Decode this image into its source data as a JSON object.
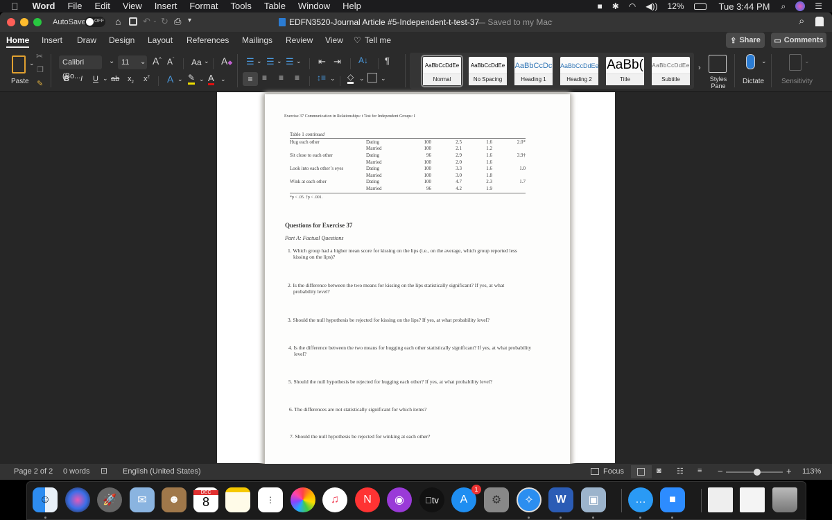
{
  "menubar": {
    "apple": "",
    "app": "Word",
    "items": [
      "File",
      "Edit",
      "View",
      "Insert",
      "Format",
      "Tools",
      "Table",
      "Window",
      "Help"
    ],
    "battery": "12%",
    "clock": "Tue 3:44 PM"
  },
  "titlebar": {
    "autosave_label": "AutoSave",
    "autosave_state": "OFF",
    "doc_title": "EDFN3520-Journal Article #5-Independent-t-test-37",
    "save_status": "— Saved to my Mac"
  },
  "tabs": [
    "Home",
    "Insert",
    "Draw",
    "Design",
    "Layout",
    "References",
    "Mailings",
    "Review",
    "View"
  ],
  "tell_me": "Tell me",
  "share_label": "Share",
  "comments_label": "Comments",
  "ribbon": {
    "paste_label": "Paste",
    "font_name": "Calibri (Bo...",
    "font_size": "11",
    "change_case": "Aa",
    "styles": [
      {
        "sample": "AaBbCcDdEe",
        "label": "Normal"
      },
      {
        "sample": "AaBbCcDdEe",
        "label": "No Spacing"
      },
      {
        "sample": "AaBbCcDc",
        "label": "Heading 1"
      },
      {
        "sample": "AaBbCcDdEe",
        "label": "Heading 2"
      },
      {
        "sample": "AaBb(",
        "label": "Title"
      },
      {
        "sample": "AaBbCcDdEe",
        "label": "Subtitle"
      }
    ],
    "styles_pane_label": "Styles Pane",
    "dictate_label": "Dictate",
    "sensitivity_label": "Sensitivity"
  },
  "document": {
    "running_head": "Exercise 37   Communication in Relationships: t Test for Independent Groups: I",
    "table_caption": "Table 1",
    "table_caption_italic": "continued",
    "rows": [
      {
        "item": "Hug each other",
        "group": "Dating",
        "n": "100",
        "m": "2.5",
        "sd": "1.6",
        "t": "2.0*"
      },
      {
        "item": "",
        "group": "Married",
        "n": "100",
        "m": "2.1",
        "sd": "1.2",
        "t": ""
      },
      {
        "item": "Sit close to each other",
        "group": "Dating",
        "n": "96",
        "m": "2.9",
        "sd": "1.6",
        "t": "3.9†"
      },
      {
        "item": "",
        "group": "Married",
        "n": "100",
        "m": "2.0",
        "sd": "1.6",
        "t": ""
      },
      {
        "item": "Look into each other’s eyes",
        "group": "Dating",
        "n": "100",
        "m": "3.3",
        "sd": "1.6",
        "t": "1.0"
      },
      {
        "item": "",
        "group": "Married",
        "n": "100",
        "m": "3.0",
        "sd": "1.8",
        "t": ""
      },
      {
        "item": "Wink at each other",
        "group": "Dating",
        "n": "100",
        "m": "4.7",
        "sd": "2.3",
        "t": "1.7"
      },
      {
        "item": "",
        "group": "Married",
        "n": "96",
        "m": "4.2",
        "sd": "1.9",
        "t": ""
      }
    ],
    "footnote": "*p < .05. †p < .001.",
    "questions_heading": "Questions for Exercise 37",
    "part_heading": "Part A: Factual Questions",
    "questions": [
      "1. Which group had a higher mean score for kissing on the lips (i.e., on the average, which group reported less kissing on the lips)?",
      "2. Is the difference between the two means for kissing on the lips statistically significant? If yes, at what probability level?",
      "3. Should the null hypothesis be rejected for kissing on the lips? If yes, at what probability level?",
      "4. Is the difference between the two means for hugging each other statistically significant? If yes, at what probability level?",
      "5. Should the null hypothesis be rejected for hugging each other? If yes, at what probability level?",
      "6. The differences are not statistically significant for which items?",
      "7. Should the null hypothesis be rejected for winking at each other?"
    ]
  },
  "statusbar": {
    "page": "Page 2 of 2",
    "words": "0 words",
    "language": "English (United States)",
    "focus": "Focus",
    "zoom": "113%",
    "zoom_level": 0.55
  },
  "dock": {
    "calendar_month": "DEC",
    "calendar_day": "8",
    "appstore_badge": "1",
    "tv_label": "tv",
    "word_letter": "W"
  },
  "colors": {
    "accent_blue": "#2b7cd3",
    "traffic_red": "#fe5f57",
    "traffic_yellow": "#febc2e",
    "traffic_green": "#28c840"
  }
}
